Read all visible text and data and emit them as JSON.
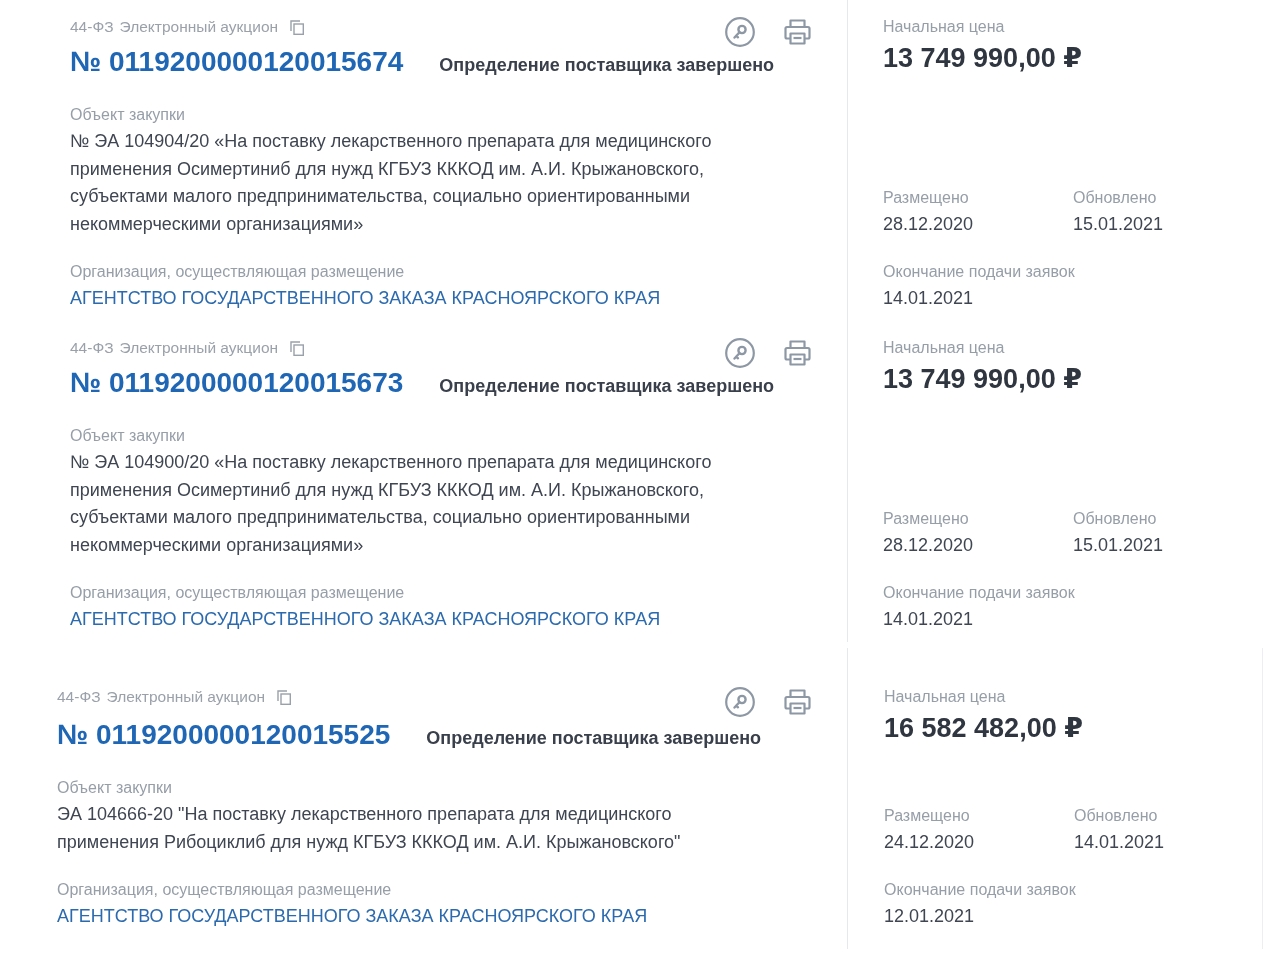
{
  "procurements": [
    {
      "law": "44-ФЗ",
      "method": "Электронный аукцион",
      "number": "№ 0119200000120015674",
      "status": "Определение поставщика завершено",
      "object_label": "Объект закупки",
      "object": "№ ЭА 104904/20 «На поставку лекарственного препарата для медицинского применения Осимертиниб для нужд КГБУЗ КККОД им. А.И. Крыжановского, субъектами малого предпринимательства, социально ориентированными некоммерческими организациями»",
      "organization_label": "Организация, осуществляющая размещение",
      "organization": "АГЕНТСТВО ГОСУДАРСТВЕННОГО ЗАКАЗА КРАСНОЯРСКОГО КРАЯ",
      "price_label": "Начальная цена",
      "price": "13 749 990,00 ₽",
      "posted_label": "Размещено",
      "posted": "28.12.2020",
      "updated_label": "Обновлено",
      "updated": "15.01.2021",
      "deadline_label": "Окончание подачи заявок",
      "deadline": "14.01.2021"
    },
    {
      "law": "44-ФЗ",
      "method": "Электронный аукцион",
      "number": "№ 0119200000120015673",
      "status": "Определение поставщика завершено",
      "object_label": "Объект закупки",
      "object": "№ ЭА 104900/20 «На поставку лекарственного препарата для медицинского применения Осимертиниб для нужд КГБУЗ КККОД им. А.И. Крыжановского, субъектами малого предпринимательства, социально ориентированными некоммерческими организациями»",
      "organization_label": "Организация, осуществляющая размещение",
      "organization": "АГЕНТСТВО ГОСУДАРСТВЕННОГО ЗАКАЗА КРАСНОЯРСКОГО КРАЯ",
      "price_label": "Начальная цена",
      "price": "13 749 990,00 ₽",
      "posted_label": "Размещено",
      "posted": "28.12.2020",
      "updated_label": "Обновлено",
      "updated": "15.01.2021",
      "deadline_label": "Окончание подачи заявок",
      "deadline": "14.01.2021"
    },
    {
      "law": "44-ФЗ",
      "method": "Электронный аукцион",
      "number": "№ 0119200000120015525",
      "status": "Определение поставщика завершено",
      "object_label": "Объект закупки",
      "object": "ЭА 104666-20 \"На поставку лекарственного препарата для медицинского применения Рибоциклиб для нужд КГБУЗ КККОД им. А.И. Крыжановского\"",
      "organization_label": "Организация, осуществляющая размещение",
      "organization": "АГЕНТСТВО ГОСУДАРСТВЕННОГО ЗАКАЗА КРАСНОЯРСКОГО КРАЯ",
      "price_label": "Начальная цена",
      "price": "16 582 482,00 ₽",
      "posted_label": "Размещено",
      "posted": "24.12.2020",
      "updated_label": "Обновлено",
      "updated": "14.01.2021",
      "deadline_label": "Окончание подачи заявок",
      "deadline": "12.01.2021"
    }
  ]
}
